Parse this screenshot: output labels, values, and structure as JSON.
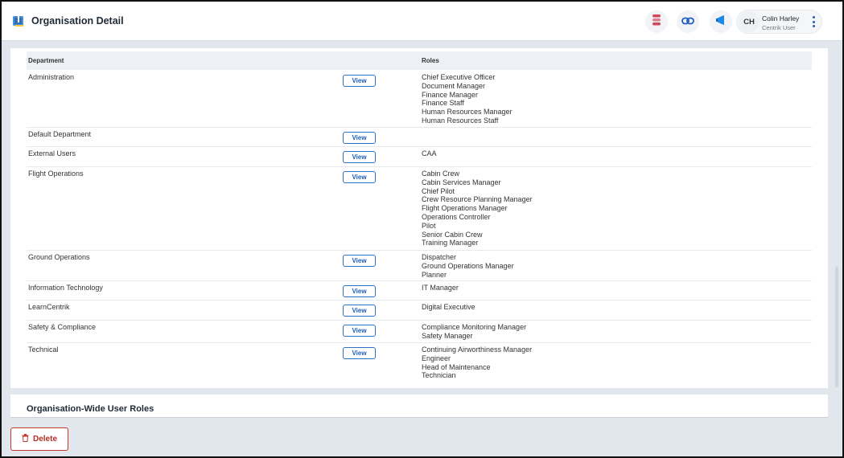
{
  "header": {
    "title": "Organisation Detail",
    "app_icon": "organisation-book-icon",
    "actions": [
      {
        "name": "stack-icon",
        "color": "#d6455a"
      },
      {
        "name": "link-icon",
        "color": "#1e5fbf"
      },
      {
        "name": "megaphone-icon",
        "color": "#1e88e5"
      }
    ],
    "user": {
      "initials": "CH",
      "name": "Colin Harley",
      "role": "Centrik User"
    }
  },
  "table": {
    "columns": [
      "Department",
      "Roles"
    ],
    "view_label": "View",
    "rows": [
      {
        "department": "Administration",
        "roles": [
          "Chief Executive Officer",
          "Document Manager",
          "Finance Manager",
          "Finance Staff",
          "Human Resources Manager",
          "Human Resources Staff"
        ]
      },
      {
        "department": "Default Department",
        "roles": []
      },
      {
        "department": "External Users",
        "roles": [
          "CAA"
        ]
      },
      {
        "department": "Flight Operations",
        "roles": [
          "Cabin Crew",
          "Cabin Services Manager",
          "Chief Pilot",
          "Crew Resource Planning Manager",
          "Flight Operations Manager",
          "Operations Controller",
          "Pilot",
          "Senior Cabin Crew",
          "Training Manager"
        ]
      },
      {
        "department": "Ground Operations",
        "roles": [
          "Dispatcher",
          "Ground Operations Manager",
          "Planner"
        ]
      },
      {
        "department": "Information Technology",
        "roles": [
          "IT Manager"
        ]
      },
      {
        "department": "LearnCentrik",
        "roles": [
          "Digital Executive"
        ]
      },
      {
        "department": "Safety & Compliance",
        "roles": [
          "Compliance Monitoring Manager",
          "Safety Manager"
        ]
      },
      {
        "department": "Technical",
        "roles": [
          "Continuing Airworthiness Manager",
          "Engineer",
          "Head of Maintenance",
          "Technician"
        ]
      }
    ]
  },
  "section2": {
    "title": "Organisation-Wide User Roles"
  },
  "footer": {
    "delete_label": "Delete"
  },
  "colors": {
    "accent": "#1e5fbf",
    "danger": "#c0392b",
    "background": "#e2e7ee"
  }
}
